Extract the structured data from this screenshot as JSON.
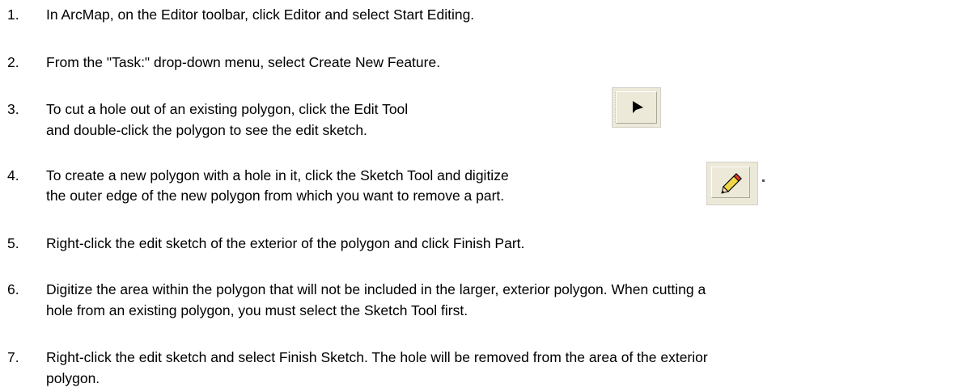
{
  "steps": [
    {
      "number": "1.",
      "lines": [
        "In ArcMap, on the Editor toolbar, click Editor and select Start Editing."
      ]
    },
    {
      "number": "2.",
      "lines": [
        "From the \"Task:\" drop-down menu, select Create New Feature."
      ]
    },
    {
      "number": "3.",
      "lines": [
        "To cut a hole out of an existing polygon, click the Edit Tool",
        " and double-click the polygon to see the edit sketch."
      ],
      "icon": "edit-tool-arrow-icon"
    },
    {
      "number": "4.",
      "lines": [
        "To create a new polygon with a hole in it, click the Sketch Tool and digitize",
        "the outer edge of the new polygon from which you want to remove a part."
      ],
      "icon": "sketch-tool-pencil-icon"
    },
    {
      "number": "5.",
      "lines": [
        "Right-click the edit sketch of the exterior of the polygon and click Finish Part."
      ]
    },
    {
      "number": "6.",
      "lines": [
        "Digitize the area within the polygon that will not be included in the larger, exterior polygon. When cutting a",
        "hole from an existing polygon, you must select the Sketch Tool first."
      ]
    },
    {
      "number": "7.",
      "lines": [
        "Right-click the edit sketch and select Finish Sketch. The hole will be removed from the area of the exterior",
        "polygon."
      ]
    }
  ]
}
